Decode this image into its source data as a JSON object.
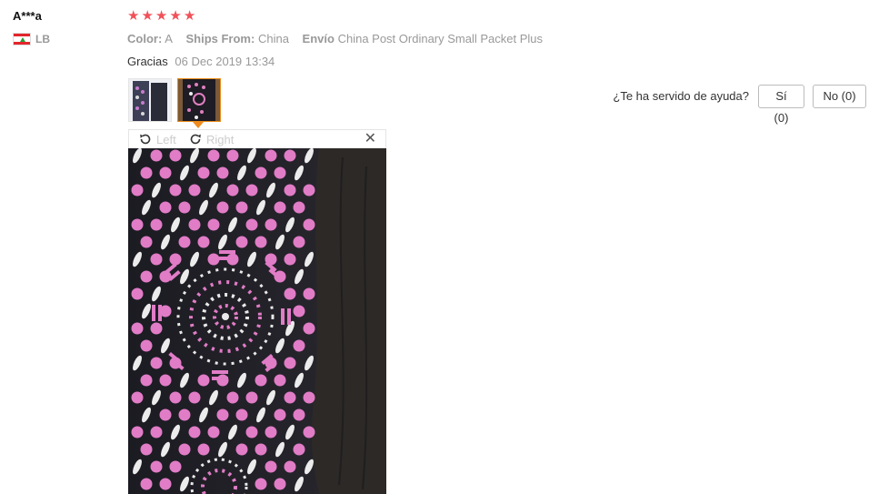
{
  "review": {
    "username": "A***a",
    "country_code": "LB",
    "rating": 5,
    "stars": [
      "★",
      "★",
      "★",
      "★",
      "★"
    ],
    "star_color": "#f0515a",
    "specs": {
      "color_key": "Color:",
      "color_value": "A",
      "ships_key": "Ships From:",
      "ships_value": "China",
      "envio_key": "Envío",
      "envio_value": "China Post Ordinary Small Packet Plus"
    },
    "feedback_text": "Gracias",
    "date": "06 Dec 2019 13:34",
    "thumbnails": [
      {
        "icon": "photo-thumbnail",
        "selected": false
      },
      {
        "icon": "photo-thumbnail",
        "selected": true
      }
    ]
  },
  "viewer": {
    "rotate_left_label": "Left",
    "rotate_right_label": "Right",
    "close_icon": "close-icon"
  },
  "helpful": {
    "question": "¿Te ha servido de ayuda?",
    "yes_label": "Sí (0)",
    "no_label": "No (0)"
  },
  "colors": {
    "accent": "#f08b1e",
    "muted": "#999999"
  }
}
